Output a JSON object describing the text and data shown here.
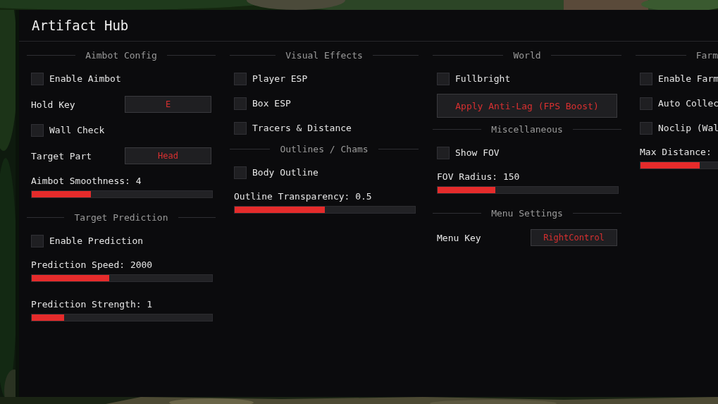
{
  "window": {
    "title": "Artifact Hub"
  },
  "columns": [
    {
      "sections": [
        {
          "title": "Aimbot Config",
          "items": [
            {
              "kind": "checkbox",
              "label": "Enable Aimbot",
              "checked": false
            },
            {
              "kind": "keybind",
              "label": "Hold Key",
              "value": "E"
            },
            {
              "kind": "checkbox",
              "label": "Wall Check",
              "checked": false
            },
            {
              "kind": "keybind",
              "label": "Target Part",
              "value": "Head"
            },
            {
              "kind": "slider",
              "label": "Aimbot Smoothness: 4",
              "level": 0.33
            }
          ]
        },
        {
          "title": "Target Prediction",
          "items": [
            {
              "kind": "checkbox",
              "label": "Enable Prediction",
              "checked": false
            },
            {
              "kind": "slider",
              "label": "Prediction Speed: 2000",
              "level": 0.43
            },
            {
              "kind": "slider",
              "label": "Prediction Strength: 1",
              "level": 0.18
            }
          ]
        }
      ]
    },
    {
      "sections": [
        {
          "title": "Visual Effects",
          "items": [
            {
              "kind": "checkbox",
              "label": "Player ESP",
              "checked": false
            },
            {
              "kind": "checkbox",
              "label": "Box ESP",
              "checked": false
            },
            {
              "kind": "checkbox",
              "label": "Tracers & Distance",
              "checked": false
            }
          ]
        },
        {
          "title": "Outlines / Chams",
          "items": [
            {
              "kind": "checkbox",
              "label": "Body Outline",
              "checked": false
            },
            {
              "kind": "slider",
              "label": "Outline Transparency: 0.5",
              "level": 0.5
            }
          ]
        }
      ]
    },
    {
      "sections": [
        {
          "title": "World",
          "items": [
            {
              "kind": "checkbox",
              "label": "Fullbright",
              "checked": false
            },
            {
              "kind": "button",
              "label": "Apply Anti-Lag (FPS Boost)"
            }
          ]
        },
        {
          "title": "Miscellaneous",
          "items": [
            {
              "kind": "checkbox",
              "label": "Show FOV",
              "checked": false
            },
            {
              "kind": "slider",
              "label": "FOV Radius: 150",
              "level": 0.32
            }
          ]
        },
        {
          "title": "Menu Settings",
          "items": [
            {
              "kind": "keybind",
              "label": "Menu Key",
              "value": "RightControl"
            }
          ]
        }
      ]
    },
    {
      "sections": [
        {
          "title": "Farm",
          "items": [
            {
              "kind": "checkbox",
              "label": "Enable Farm",
              "checked": false
            },
            {
              "kind": "checkbox",
              "label": "Auto Collec",
              "checked": false
            },
            {
              "kind": "checkbox",
              "label": "Noclip (Wal",
              "checked": false
            },
            {
              "kind": "slider",
              "label": "Max Distance:",
              "level": 0.33
            }
          ]
        }
      ]
    }
  ]
}
